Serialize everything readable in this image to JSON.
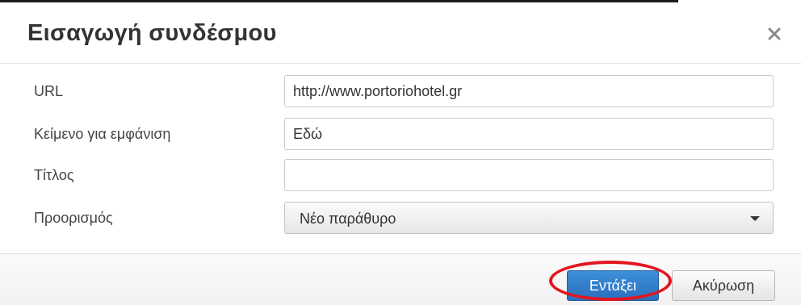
{
  "dialog": {
    "title": "Εισαγωγή συνδέσμου",
    "close_icon": "close-icon",
    "close_symbol": "×"
  },
  "form": {
    "url": {
      "label": "URL",
      "value": "http://www.portoriohotel.gr"
    },
    "text": {
      "label": "Κείμενο για εμφάνιση",
      "value": "Εδώ"
    },
    "title": {
      "label": "Τίτλος",
      "value": ""
    },
    "target": {
      "label": "Προορισμός",
      "selected": "Νέο παράθυρο",
      "icon": "chevron-down-icon"
    }
  },
  "footer": {
    "ok_label": "Εντάξει",
    "cancel_label": "Ακύρωση"
  },
  "colors": {
    "primary_button": "#2f7cc8",
    "annotation_highlight": "#e3151e"
  }
}
